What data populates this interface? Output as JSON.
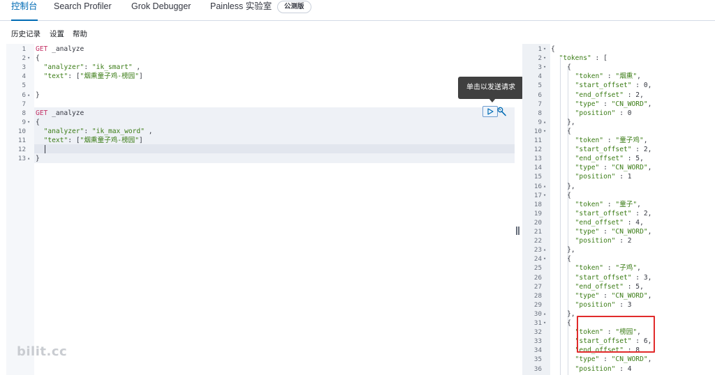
{
  "tabs": [
    {
      "label": "控制台",
      "active": true
    },
    {
      "label": "Search Profiler",
      "active": false
    },
    {
      "label": "Grok Debugger",
      "active": false
    },
    {
      "label": "Painless 实验室",
      "active": false
    }
  ],
  "badge": "公测版",
  "menu": [
    "历史记录",
    "设置",
    "帮助"
  ],
  "tooltip": "单击以发送请求",
  "watermark": "bilit.cc",
  "colors": {
    "accent": "#006bb4",
    "method": "#c43367",
    "string": "#3b7c16",
    "highlight_box": "#e12b2b"
  },
  "icons": {
    "run": "play-icon",
    "settings": "wrench-icon",
    "resize": "pane-resizer-icon"
  },
  "request_editor": {
    "lines": [
      {
        "n": "1",
        "fold": "",
        "segs": [
          [
            "m",
            "GET"
          ],
          [
            "u",
            " _analyze"
          ]
        ]
      },
      {
        "n": "2",
        "fold": "▾",
        "segs": [
          [
            "u",
            "{"
          ]
        ]
      },
      {
        "n": "3",
        "fold": "",
        "segs": [
          [
            "u",
            "  "
          ],
          [
            "k",
            "\"analyzer\""
          ],
          [
            "u",
            ": "
          ],
          [
            "s",
            "\"ik_smart\""
          ],
          [
            "u",
            " ,"
          ]
        ]
      },
      {
        "n": "4",
        "fold": "",
        "segs": [
          [
            "u",
            "  "
          ],
          [
            "k",
            "\"text\""
          ],
          [
            "u",
            ": ["
          ],
          [
            "s",
            "\"烟熏童子鸡-榜园\""
          ],
          [
            "u",
            "]"
          ]
        ]
      },
      {
        "n": "5",
        "fold": "",
        "segs": []
      },
      {
        "n": "6",
        "fold": "▴",
        "segs": [
          [
            "u",
            "}"
          ]
        ]
      },
      {
        "n": "7",
        "fold": "",
        "segs": []
      },
      {
        "n": "8",
        "fold": "",
        "segs": [
          [
            "m",
            "GET"
          ],
          [
            "u",
            " _analyze"
          ]
        ]
      },
      {
        "n": "9",
        "fold": "▾",
        "segs": [
          [
            "u",
            "{"
          ]
        ]
      },
      {
        "n": "10",
        "fold": "",
        "segs": [
          [
            "u",
            "  "
          ],
          [
            "k",
            "\"analyzer\""
          ],
          [
            "u",
            ": "
          ],
          [
            "s",
            "\"ik_max_word\""
          ],
          [
            "u",
            " ,"
          ]
        ]
      },
      {
        "n": "11",
        "fold": "",
        "segs": [
          [
            "u",
            "  "
          ],
          [
            "k",
            "\"text\""
          ],
          [
            "u",
            ": ["
          ],
          [
            "s",
            "\"烟熏童子鸡-榜园\""
          ],
          [
            "u",
            "]"
          ]
        ]
      },
      {
        "n": "12",
        "fold": "",
        "segs": []
      },
      {
        "n": "13",
        "fold": "▴",
        "segs": [
          [
            "u",
            "}"
          ]
        ]
      }
    ]
  },
  "response_viewer": {
    "lines": [
      {
        "n": "1",
        "fold": "▾",
        "segs": [
          [
            "u",
            "{"
          ]
        ]
      },
      {
        "n": "2",
        "fold": "▾",
        "segs": [
          [
            "u",
            "  "
          ],
          [
            "k",
            "\"tokens\""
          ],
          [
            "u",
            " : ["
          ]
        ]
      },
      {
        "n": "3",
        "fold": "▾",
        "segs": [
          [
            "u",
            "    {"
          ]
        ]
      },
      {
        "n": "4",
        "fold": "",
        "segs": [
          [
            "u",
            "      "
          ],
          [
            "k",
            "\"token\""
          ],
          [
            "u",
            " : "
          ],
          [
            "s",
            "\"烟熏\""
          ],
          [
            "u",
            ","
          ]
        ]
      },
      {
        "n": "5",
        "fold": "",
        "segs": [
          [
            "u",
            "      "
          ],
          [
            "k",
            "\"start_offset\""
          ],
          [
            "u",
            " : 0,"
          ]
        ]
      },
      {
        "n": "6",
        "fold": "",
        "segs": [
          [
            "u",
            "      "
          ],
          [
            "k",
            "\"end_offset\""
          ],
          [
            "u",
            " : 2,"
          ]
        ]
      },
      {
        "n": "7",
        "fold": "",
        "segs": [
          [
            "u",
            "      "
          ],
          [
            "k",
            "\"type\""
          ],
          [
            "u",
            " : "
          ],
          [
            "s",
            "\"CN_WORD\""
          ],
          [
            "u",
            ","
          ]
        ]
      },
      {
        "n": "8",
        "fold": "",
        "segs": [
          [
            "u",
            "      "
          ],
          [
            "k",
            "\"position\""
          ],
          [
            "u",
            " : 0"
          ]
        ]
      },
      {
        "n": "9",
        "fold": "▴",
        "segs": [
          [
            "u",
            "    },"
          ]
        ]
      },
      {
        "n": "10",
        "fold": "▾",
        "segs": [
          [
            "u",
            "    {"
          ]
        ]
      },
      {
        "n": "11",
        "fold": "",
        "segs": [
          [
            "u",
            "      "
          ],
          [
            "k",
            "\"token\""
          ],
          [
            "u",
            " : "
          ],
          [
            "s",
            "\"童子鸡\""
          ],
          [
            "u",
            ","
          ]
        ]
      },
      {
        "n": "12",
        "fold": "",
        "segs": [
          [
            "u",
            "      "
          ],
          [
            "k",
            "\"start_offset\""
          ],
          [
            "u",
            " : 2,"
          ]
        ]
      },
      {
        "n": "13",
        "fold": "",
        "segs": [
          [
            "u",
            "      "
          ],
          [
            "k",
            "\"end_offset\""
          ],
          [
            "u",
            " : 5,"
          ]
        ]
      },
      {
        "n": "14",
        "fold": "",
        "segs": [
          [
            "u",
            "      "
          ],
          [
            "k",
            "\"type\""
          ],
          [
            "u",
            " : "
          ],
          [
            "s",
            "\"CN_WORD\""
          ],
          [
            "u",
            ","
          ]
        ]
      },
      {
        "n": "15",
        "fold": "",
        "segs": [
          [
            "u",
            "      "
          ],
          [
            "k",
            "\"position\""
          ],
          [
            "u",
            " : 1"
          ]
        ]
      },
      {
        "n": "16",
        "fold": "▴",
        "segs": [
          [
            "u",
            "    },"
          ]
        ]
      },
      {
        "n": "17",
        "fold": "▾",
        "segs": [
          [
            "u",
            "    {"
          ]
        ]
      },
      {
        "n": "18",
        "fold": "",
        "segs": [
          [
            "u",
            "      "
          ],
          [
            "k",
            "\"token\""
          ],
          [
            "u",
            " : "
          ],
          [
            "s",
            "\"童子\""
          ],
          [
            "u",
            ","
          ]
        ]
      },
      {
        "n": "19",
        "fold": "",
        "segs": [
          [
            "u",
            "      "
          ],
          [
            "k",
            "\"start_offset\""
          ],
          [
            "u",
            " : 2,"
          ]
        ]
      },
      {
        "n": "20",
        "fold": "",
        "segs": [
          [
            "u",
            "      "
          ],
          [
            "k",
            "\"end_offset\""
          ],
          [
            "u",
            " : 4,"
          ]
        ]
      },
      {
        "n": "21",
        "fold": "",
        "segs": [
          [
            "u",
            "      "
          ],
          [
            "k",
            "\"type\""
          ],
          [
            "u",
            " : "
          ],
          [
            "s",
            "\"CN_WORD\""
          ],
          [
            "u",
            ","
          ]
        ]
      },
      {
        "n": "22",
        "fold": "",
        "segs": [
          [
            "u",
            "      "
          ],
          [
            "k",
            "\"position\""
          ],
          [
            "u",
            " : 2"
          ]
        ]
      },
      {
        "n": "23",
        "fold": "▴",
        "segs": [
          [
            "u",
            "    },"
          ]
        ]
      },
      {
        "n": "24",
        "fold": "▾",
        "segs": [
          [
            "u",
            "    {"
          ]
        ]
      },
      {
        "n": "25",
        "fold": "",
        "segs": [
          [
            "u",
            "      "
          ],
          [
            "k",
            "\"token\""
          ],
          [
            "u",
            " : "
          ],
          [
            "s",
            "\"子鸡\""
          ],
          [
            "u",
            ","
          ]
        ]
      },
      {
        "n": "26",
        "fold": "",
        "segs": [
          [
            "u",
            "      "
          ],
          [
            "k",
            "\"start_offset\""
          ],
          [
            "u",
            " : 3,"
          ]
        ]
      },
      {
        "n": "27",
        "fold": "",
        "segs": [
          [
            "u",
            "      "
          ],
          [
            "k",
            "\"end_offset\""
          ],
          [
            "u",
            " : 5,"
          ]
        ]
      },
      {
        "n": "28",
        "fold": "",
        "segs": [
          [
            "u",
            "      "
          ],
          [
            "k",
            "\"type\""
          ],
          [
            "u",
            " : "
          ],
          [
            "s",
            "\"CN_WORD\""
          ],
          [
            "u",
            ","
          ]
        ]
      },
      {
        "n": "29",
        "fold": "",
        "segs": [
          [
            "u",
            "      "
          ],
          [
            "k",
            "\"position\""
          ],
          [
            "u",
            " : 3"
          ]
        ]
      },
      {
        "n": "30",
        "fold": "▴",
        "segs": [
          [
            "u",
            "    },"
          ]
        ]
      },
      {
        "n": "31",
        "fold": "▾",
        "segs": [
          [
            "u",
            "    {"
          ]
        ]
      },
      {
        "n": "32",
        "fold": "",
        "segs": [
          [
            "u",
            "      "
          ],
          [
            "k",
            "\"token\""
          ],
          [
            "u",
            " : "
          ],
          [
            "s",
            "\"榜园\""
          ],
          [
            "u",
            ","
          ]
        ]
      },
      {
        "n": "33",
        "fold": "",
        "segs": [
          [
            "u",
            "      "
          ],
          [
            "k",
            "\"start_offset\""
          ],
          [
            "u",
            " : 6,"
          ]
        ]
      },
      {
        "n": "34",
        "fold": "",
        "segs": [
          [
            "u",
            "      "
          ],
          [
            "k",
            "\"end_offset\""
          ],
          [
            "u",
            " : 8"
          ]
        ]
      },
      {
        "n": "35",
        "fold": "",
        "segs": [
          [
            "u",
            "      "
          ],
          [
            "k",
            "\"type\""
          ],
          [
            "u",
            " : "
          ],
          [
            "s",
            "\"CN_WORD\""
          ],
          [
            "u",
            ","
          ]
        ]
      },
      {
        "n": "36",
        "fold": "",
        "segs": [
          [
            "u",
            "      "
          ],
          [
            "k",
            "\"position\""
          ],
          [
            "u",
            " : 4"
          ]
        ]
      }
    ]
  }
}
